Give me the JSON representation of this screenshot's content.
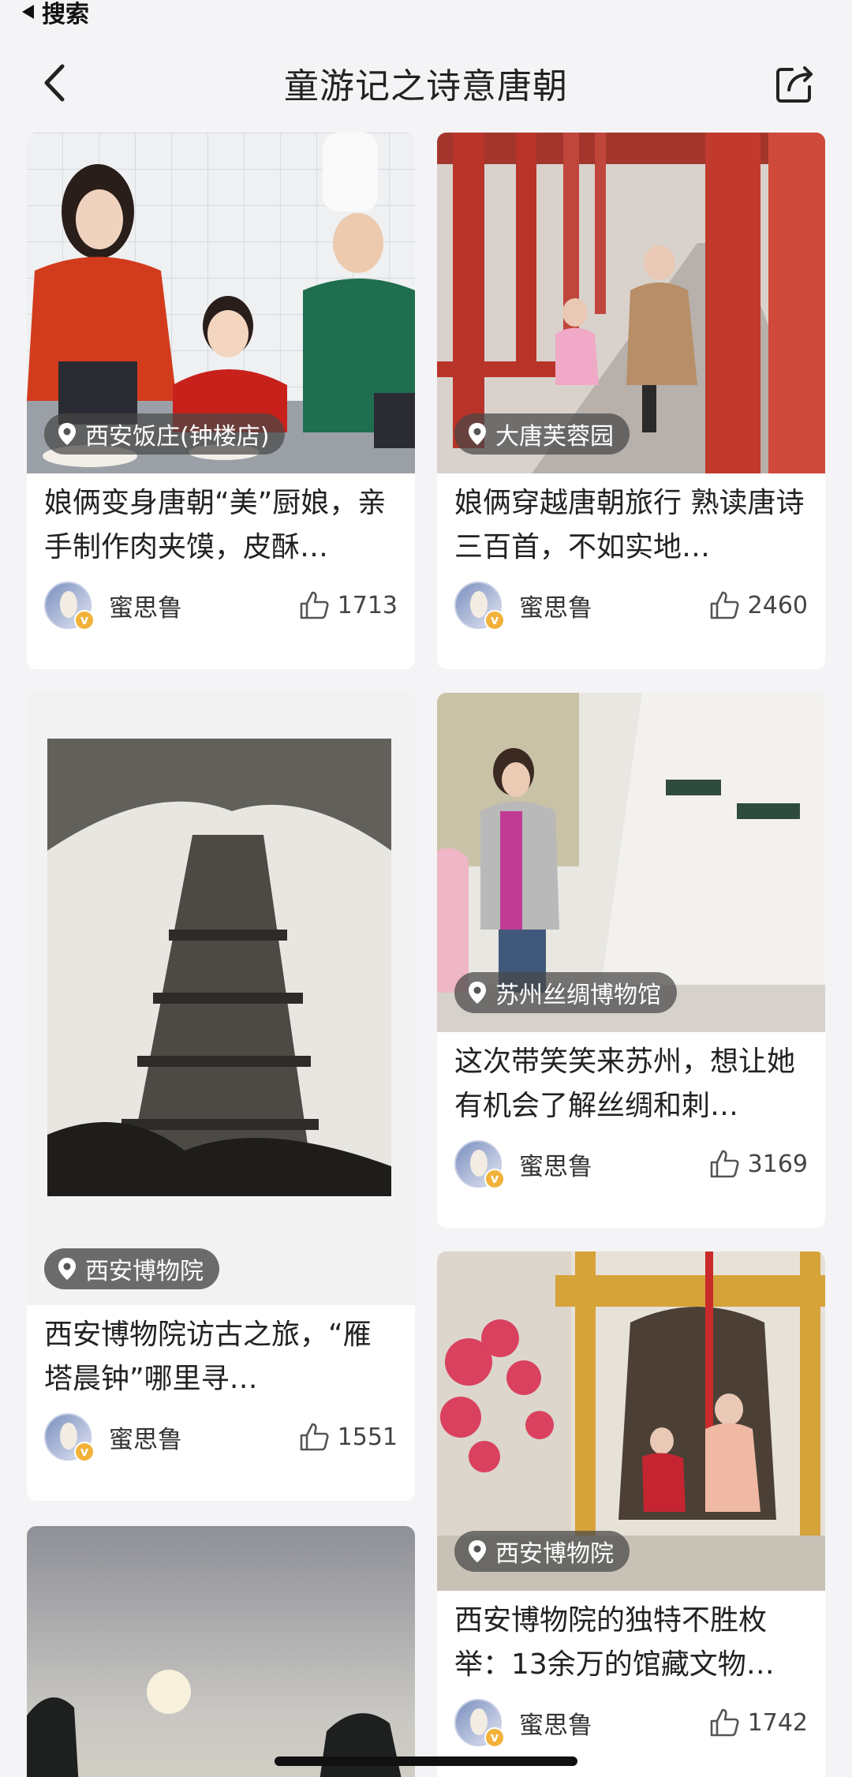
{
  "status_bar": {
    "back_label": "搜索"
  },
  "header": {
    "title": "童游记之诗意唐朝"
  },
  "cards": [
    {
      "location": "西安饭庄(钟楼店)",
      "title": "娘俩变身唐朝“美”厨娘，亲手制作肉夹馍，皮酥…",
      "author": "蜜思鲁",
      "likes": "1713"
    },
    {
      "location": "大唐芙蓉园",
      "title": "娘俩穿越唐朝旅行 熟读唐诗三百首，不如实地…",
      "author": "蜜思鲁",
      "likes": "2460"
    },
    {
      "location": "西安博物院",
      "title": "西安博物院访古之旅，“雁塔晨钟”哪里寻…",
      "author": "蜜思鲁",
      "likes": "1551"
    },
    {
      "location": "苏州丝绸博物馆",
      "title": "这次带笑笑来苏州，想让她有机会了解丝绸和刺…",
      "author": "蜜思鲁",
      "likes": "3169"
    },
    {
      "location": "西安博物院",
      "title": "西安博物院的独特不胜枚举：13余万的馆藏文物…",
      "author": "蜜思鲁",
      "likes": "1742"
    }
  ],
  "icons": {
    "back": "chevron-left-icon",
    "share": "share-icon",
    "location": "location-pin-icon",
    "like": "thumbs-up-icon"
  },
  "colors": {
    "accent_badge": "#f2b23a",
    "location_chip": "#464646"
  }
}
